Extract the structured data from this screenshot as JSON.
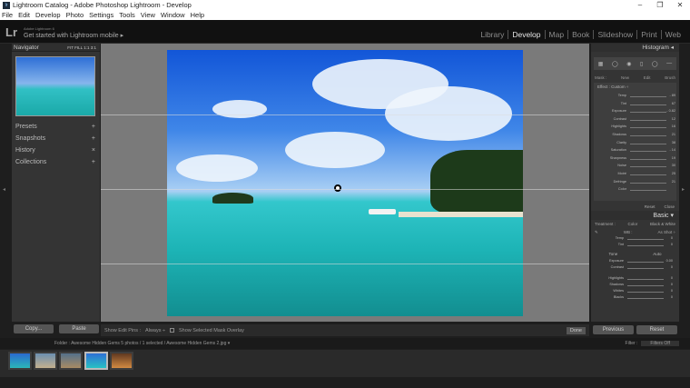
{
  "window": {
    "title": "Lightroom Catalog - Adobe Photoshop Lightroom - Develop",
    "icon": "lr",
    "controls": [
      "–",
      "❐",
      "✕"
    ]
  },
  "menu": [
    "File",
    "Edit",
    "Develop",
    "Photo",
    "Settings",
    "Tools",
    "View",
    "Window",
    "Help"
  ],
  "identity": {
    "logo": "Lr",
    "small": "Adobe Lightroom 6",
    "mobile": "Get started with Lightroom mobile ▸"
  },
  "modules": [
    "Library",
    "Develop",
    "Map",
    "Book",
    "Slideshow",
    "Print",
    "Web"
  ],
  "active_module": "Develop",
  "left": {
    "navigator": "Navigator",
    "nav_opts": "FIT  FILL  1:1  3:1",
    "sections": [
      {
        "label": "Presets",
        "mark": "+"
      },
      {
        "label": "Snapshots",
        "mark": "+"
      },
      {
        "label": "History",
        "mark": "×"
      },
      {
        "label": "Collections",
        "mark": "+"
      }
    ],
    "copy": "Copy...",
    "paste": "Paste"
  },
  "toolstrip": {
    "show_edit": "Show Edit Pins :",
    "always": "Always ÷",
    "overlay": "Show Selected Mask Overlay",
    "done": "Done"
  },
  "right": {
    "histogram": "Histogram ◂",
    "tools": [
      "▦",
      "◯",
      "◉",
      "▯",
      "◯",
      "—"
    ],
    "mask_tabs": [
      "Mask :",
      "New",
      "Edit",
      "Brush"
    ],
    "effect": "Effect :  Custom ÷",
    "sliders1": [
      {
        "label": "Temp",
        "value": "- 89"
      },
      {
        "label": "Tint",
        "value": "67"
      },
      {
        "label": "Exposure",
        "value": "- 0.82"
      },
      {
        "label": "Contrast",
        "value": "12"
      },
      {
        "label": "Highlights",
        "value": "16"
      },
      {
        "label": "Shadows",
        "value": "21"
      },
      {
        "label": "Clarity",
        "value": "38"
      },
      {
        "label": "Saturation",
        "value": "- 14"
      },
      {
        "label": "Sharpness",
        "value": "19"
      },
      {
        "label": "Noise",
        "value": "30"
      },
      {
        "label": "Moiré",
        "value": "25"
      },
      {
        "label": "Defringe",
        "value": "21"
      },
      {
        "label": "Color",
        "value": ""
      }
    ],
    "reset": "Reset",
    "close": "Close",
    "basic": "Basic ▾",
    "treatment": "Treatment :",
    "color": "Color",
    "bw": "Black & White",
    "wb": "WB :",
    "as_shot": "As Shot ÷",
    "sliders2": [
      {
        "label": "Temp",
        "value": "0"
      },
      {
        "label": "Tint",
        "value": "0"
      }
    ],
    "tone": "Tone",
    "auto": "Auto",
    "sliders3": [
      {
        "label": "Exposure",
        "value": "0.00"
      },
      {
        "label": "Contrast",
        "value": "0"
      },
      {
        "label": "Highlights",
        "value": "0"
      },
      {
        "label": "Shadows",
        "value": "0"
      },
      {
        "label": "Whites",
        "value": "0"
      },
      {
        "label": "Blacks",
        "value": "0"
      }
    ],
    "previous": "Previous",
    "reset_btn": "Reset"
  },
  "filmbar": {
    "info": "Folder : Awesome Hidden Gems   5 photos / 1 selected / Awesome Hidden Gems  2.jpg ▾",
    "filter": "Filter :",
    "filter_value": "Filters Off"
  }
}
